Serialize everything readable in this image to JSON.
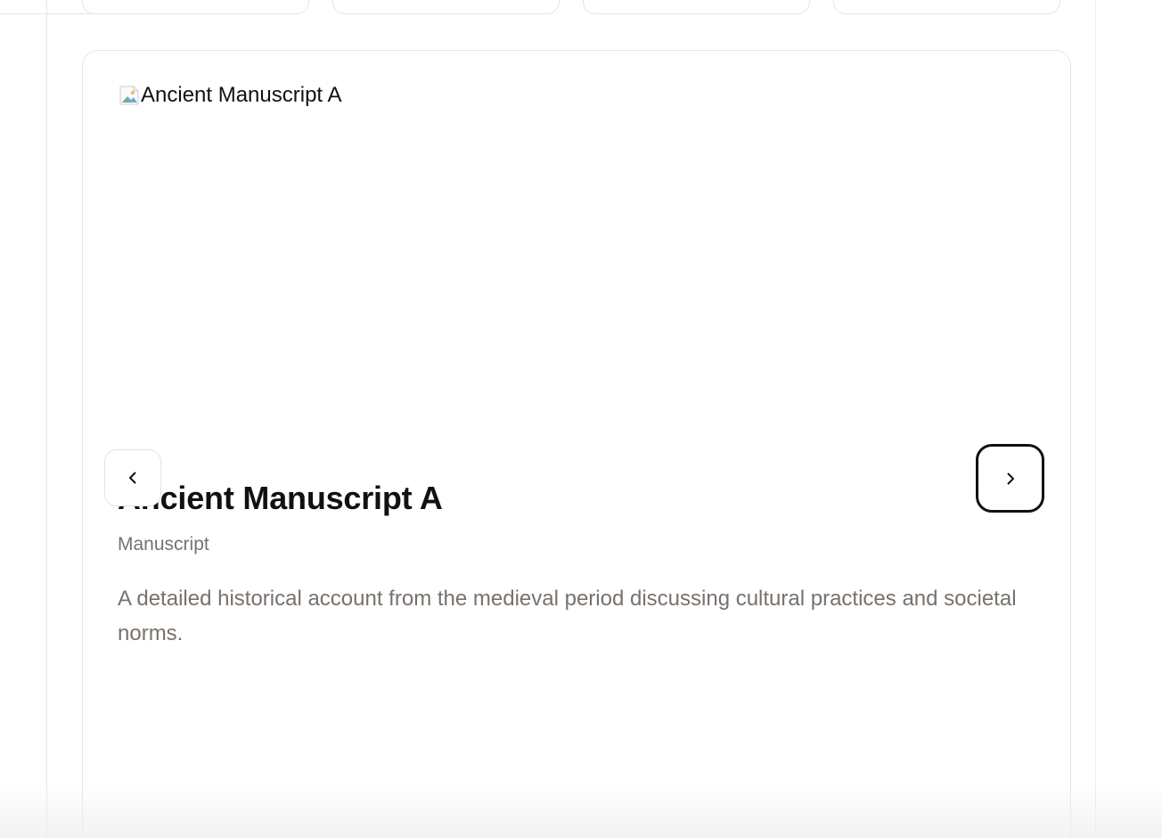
{
  "carousel": {
    "item": {
      "image_alt": "Ancient Manuscript A",
      "title": "Ancient Manuscript A",
      "category": "Manuscript",
      "description": "A detailed historical account from the medieval period discussing cultural practices and societal norms."
    },
    "controls": {
      "previous_icon": "chevron-left-icon",
      "next_icon": "chevron-right-icon",
      "active_control": "next"
    }
  },
  "colors": {
    "title": "#111111",
    "muted_text": "#78716c",
    "border": "#e4e4e7",
    "focus_ring": "#111111",
    "background": "#ffffff"
  }
}
